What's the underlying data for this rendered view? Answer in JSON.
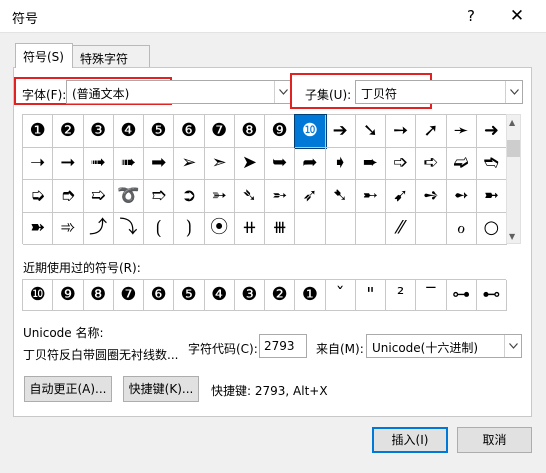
{
  "dialog": {
    "title": "符号",
    "help": "?",
    "close": "✕"
  },
  "tabs": [
    {
      "label": "符号(S)"
    },
    {
      "label": "特殊字符(P)"
    }
  ],
  "font": {
    "label": "字体(F):",
    "value": "(普通文本)"
  },
  "subset": {
    "label": "子集(U):",
    "value": "丁贝符"
  },
  "symbol_rows": [
    [
      "❶",
      "❷",
      "❸",
      "❹",
      "❺",
      "❻",
      "❼",
      "❽",
      "❾",
      "❿",
      "➔",
      "➘",
      "➙",
      "➚",
      "➛",
      "➜"
    ],
    [
      "➝",
      "➞",
      "➟",
      "➠",
      "➡",
      "➢",
      "➣",
      "➤",
      "➥",
      "➦",
      "➧",
      "➨",
      "➩",
      "➪",
      "➫",
      "➬"
    ],
    [
      "➭",
      "➮",
      "➯",
      "➰",
      "➱",
      "➲",
      "➳",
      "➴",
      "➵",
      "➶",
      "➷",
      "➸",
      "➹",
      "➺",
      "➻",
      "➼"
    ],
    [
      "➽",
      "➾",
      "⤴",
      "⤵",
      "⟮",
      "⟯",
      "⦿",
      "⧺",
      "⧻",
      "",
      "",
      "",
      "⁄⁄",
      "",
      "ℴ",
      "○"
    ]
  ],
  "selected_symbol": {
    "row": 0,
    "col": 9
  },
  "recent_label": "近期使用过的符号(R):",
  "recent_symbols": [
    "❿",
    "❾",
    "❽",
    "❼",
    "❻",
    "❺",
    "❹",
    "❸",
    "❷",
    "❶",
    "ˇ",
    "\"",
    "²",
    "‾",
    "⊶",
    "⊷"
  ],
  "unicode_name_label": "Unicode 名称:",
  "unicode_name": "丁贝符反白带圆圈无衬线数...",
  "char_code_label": "字符代码(C):",
  "char_code": "2793",
  "from_label": "来自(M):",
  "from_value": "Unicode(十六进制)",
  "autocorrect_button": "自动更正(A)...",
  "shortcut_button": "快捷键(K)...",
  "shortcut_text": "快捷键: 2793, Alt+X",
  "insert_button": "插入(I)",
  "cancel_button": "取消",
  "colors": {
    "selection": "#0078d7",
    "highlight_box": "#e02222",
    "dialog_bg": "#f0f0f0"
  }
}
